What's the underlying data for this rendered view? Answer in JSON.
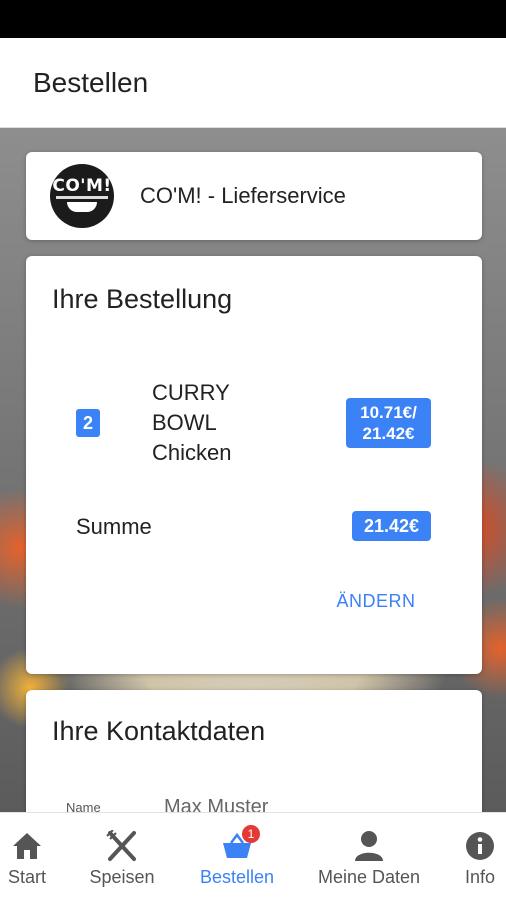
{
  "app_bar": {
    "title": "Bestellen"
  },
  "restaurant": {
    "logo_text": "CO'M!",
    "name": "CO'M! - Lieferservice"
  },
  "order": {
    "title": "Ihre Bestellung",
    "items": [
      {
        "quantity": "2",
        "name_lines": [
          "CURRY",
          "BOWL",
          "Chicken"
        ],
        "price_line1": "10.71€/",
        "price_line2": "21.42€"
      }
    ],
    "sum_label": "Summe",
    "sum_value": "21.42€",
    "change_label": "ÄNDERN"
  },
  "contact": {
    "title": "Ihre Kontaktdaten",
    "name_label": "Name",
    "name_value": "Max Muster"
  },
  "bottom_nav": {
    "items": [
      {
        "label": "Start",
        "icon": "home-icon"
      },
      {
        "label": "Speisen",
        "icon": "cutlery-icon"
      },
      {
        "label": "Bestellen",
        "icon": "basket-icon",
        "badge": "1",
        "active": true
      },
      {
        "label": "Meine Daten",
        "icon": "person-icon"
      },
      {
        "label": "Info",
        "icon": "info-icon"
      }
    ]
  },
  "colors": {
    "accent": "#3b82f6",
    "badge": "#e53935"
  }
}
